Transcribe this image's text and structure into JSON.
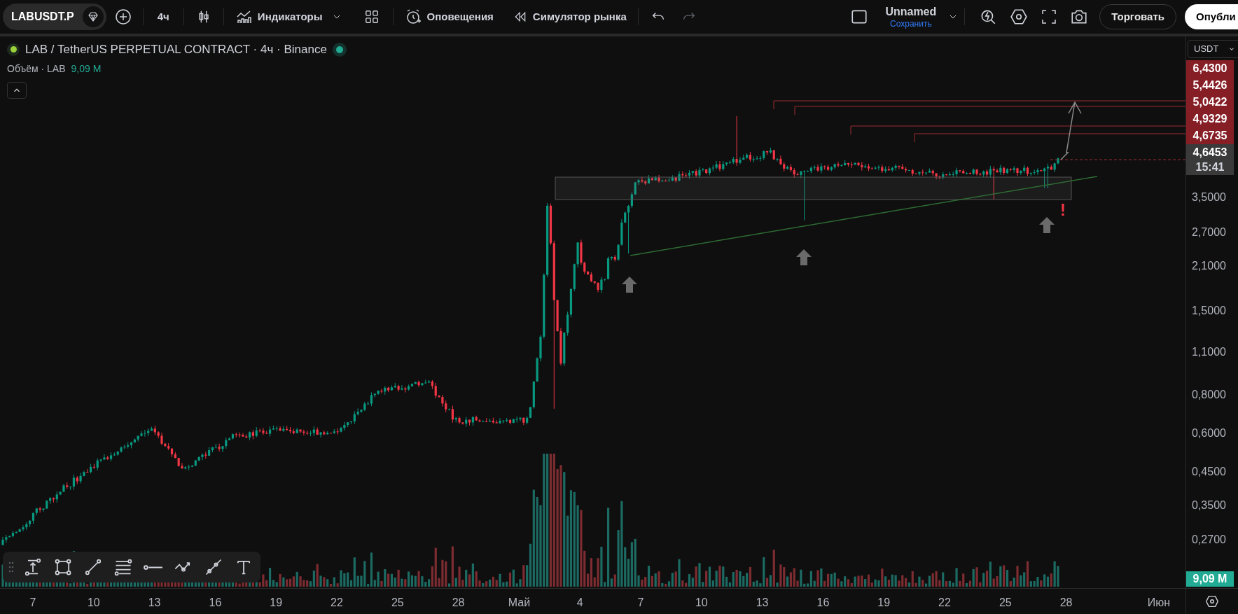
{
  "toolbar": {
    "symbol": "LABUSDT.P",
    "interval": "4ч",
    "indicators": "Индикаторы",
    "alerts": "Оповещения",
    "replay": "Симулятор рынка",
    "layout": {
      "name": "Unnamed",
      "action": "Сохранить"
    },
    "trade": "Торговать",
    "publish": "Опубли"
  },
  "legend": {
    "title": "LAB / TetherUS PERPETUAL CONTRACT · 4ч · Binance",
    "market_open": true,
    "volume_label": "Объём · LAB",
    "volume_value": "9,09 M"
  },
  "chart": {
    "warning_mark": "!"
  },
  "price_axis": {
    "currency": "USDT",
    "level_labels": [
      "6,4300",
      "5,4426",
      "5,0422",
      "4,9329",
      "4,6735"
    ],
    "last_price": "4,6453",
    "countdown": "15:41",
    "ticks": [
      "3,5000",
      "2,7000",
      "2,1000",
      "1,5000",
      "1,1000",
      "0,8000",
      "0,6000",
      "0,4500",
      "0,3500",
      "0,2700"
    ],
    "volume_label": "9,09 M"
  },
  "time_axis": {
    "ticks": [
      "7",
      "10",
      "13",
      "16",
      "19",
      "22",
      "25",
      "28",
      "Май",
      "4",
      "7",
      "10",
      "13",
      "16",
      "19",
      "22",
      "25",
      "28",
      "Июн"
    ]
  }
}
